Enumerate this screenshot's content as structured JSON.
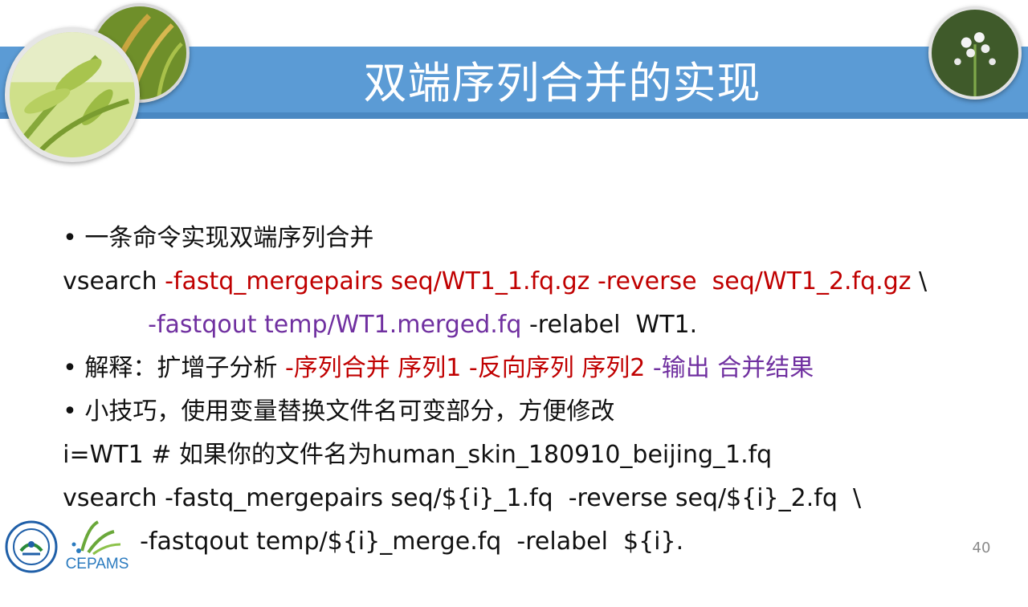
{
  "slide": {
    "title": "双端序列合并的实现",
    "page_number": "40"
  },
  "lines": [
    {
      "segments": [
        {
          "text": "• 一条命令实现双端序列合并",
          "color": "default"
        }
      ]
    },
    {
      "segments": [
        {
          "text": "vsearch ",
          "color": "default"
        },
        {
          "text": "-fastq_mergepairs seq/WT1_1.fq.gz -reverse  seq/WT1_2.fq.gz",
          "color": "red"
        },
        {
          "text": " \\",
          "color": "default"
        }
      ]
    },
    {
      "segments": [
        {
          "text": "-fastqout temp/WT1.merged.fq",
          "color": "purple"
        },
        {
          "text": " -relabel  WT1.",
          "color": "default"
        }
      ]
    },
    {
      "segments": [
        {
          "text": "• 解释：扩增子分析 ",
          "color": "default"
        },
        {
          "text": "-序列合并 序列1 -反向序列 序列2",
          "color": "red"
        },
        {
          "text": " -输出 合并结果",
          "color": "purple"
        }
      ]
    },
    {
      "segments": [
        {
          "text": "• 小技巧，使用变量替换文件名可变部分，方便修改",
          "color": "default"
        }
      ]
    },
    {
      "segments": [
        {
          "text": "i=WT1 # 如果你的文件名为human_skin_180910_beijing_1.fq",
          "color": "default"
        }
      ]
    },
    {
      "segments": [
        {
          "text": "vsearch -fastq_mergepairs seq/${i}_1.fq  -reverse seq/${i}_2.fq  \\",
          "color": "default"
        }
      ]
    },
    {
      "segments": [
        {
          "text": "-fastqout temp/${i}_merge.fq  -relabel  ${i}.",
          "color": "default"
        }
      ]
    }
  ],
  "logos": {
    "left_seal_icon": "institute-seal-icon",
    "right_logo_text": "CEPAMS"
  },
  "images": [
    "wheat-photo",
    "rice-photo",
    "white-flower-photo"
  ],
  "colors": {
    "title_bar": "#5b9bd5",
    "red_text": "#c00000",
    "purple_text": "#7030a0",
    "body_text": "#111111"
  }
}
